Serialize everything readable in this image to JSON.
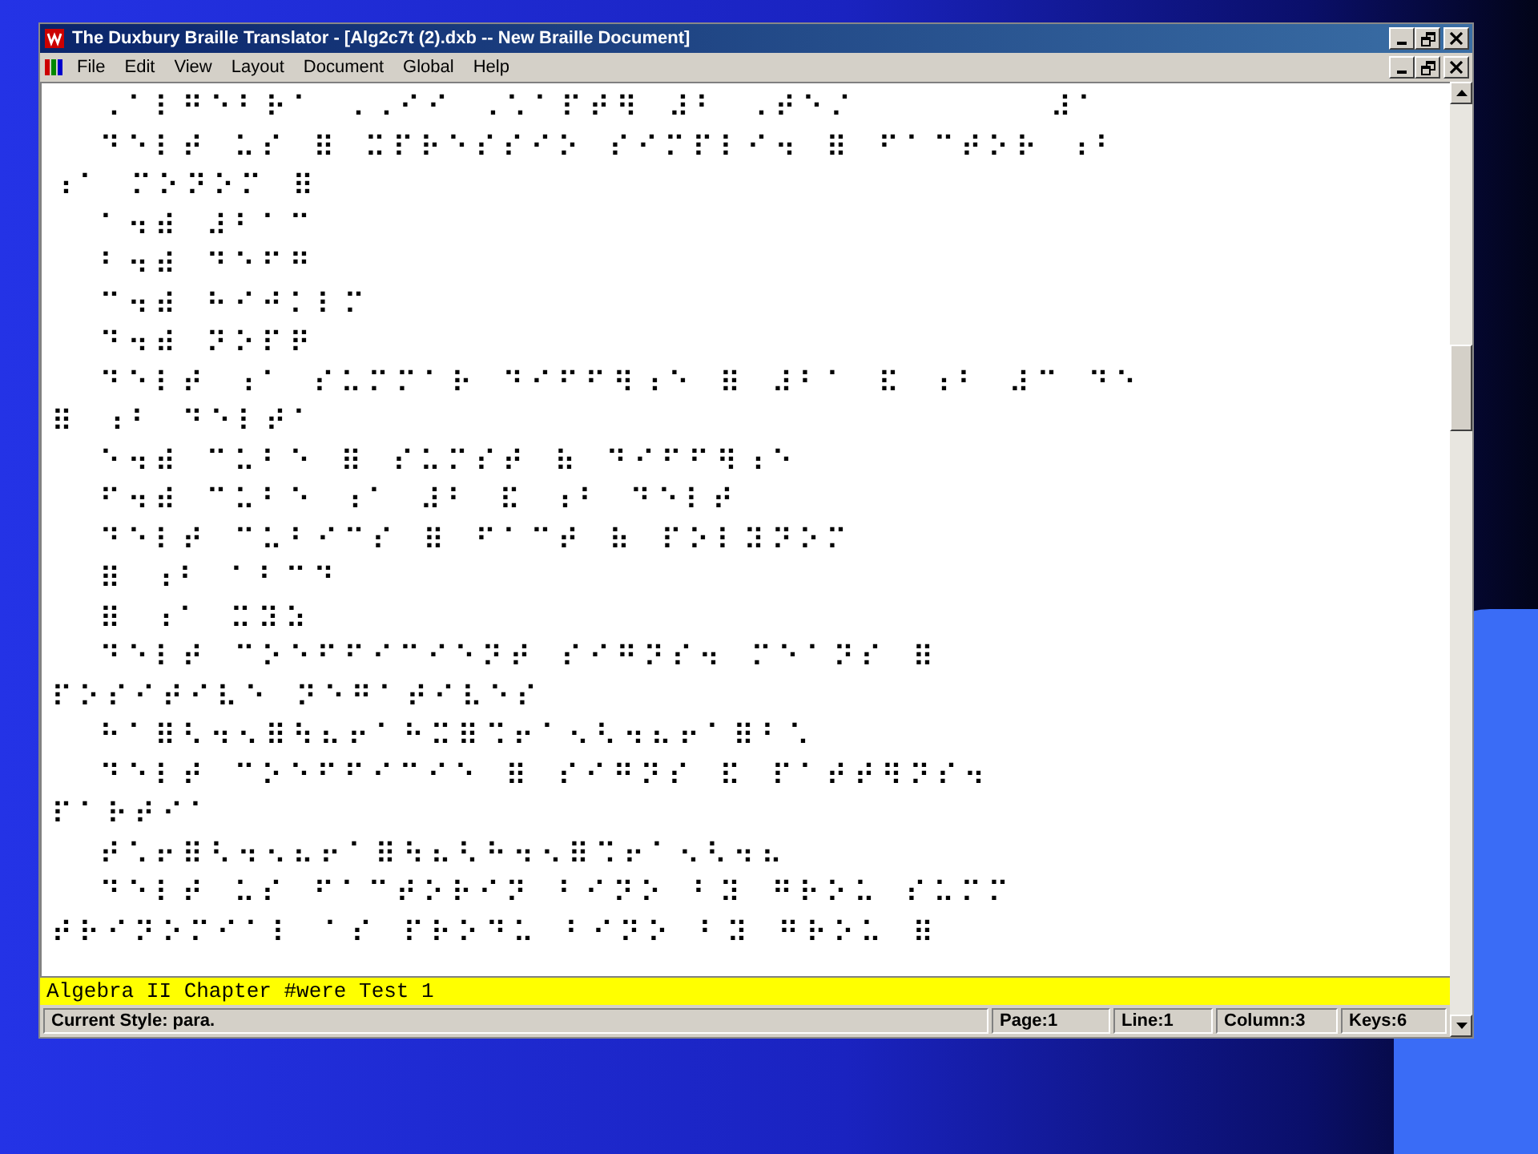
{
  "window": {
    "title": "The Duxbury Braille Translator - [Alg2c7t (2).dxb -- New Braille Document]"
  },
  "menu": [
    "File",
    "Edit",
    "View",
    "Layout",
    "Document",
    "Global",
    "Help"
  ],
  "document": {
    "lines": [
      "  ⠠⠁⠇⠛⠑⠃⠗⠁ ⠠⠠⠊⠊ ⠠⠡⠁⠏⠞⠻ ⠼⠃ ⠠⠞⠑⠌        ⠼⠁",
      "  ⠙⠑⠇⠞ ⠥⠎ ⠿ ⠭⠏⠗⠑⠎⠎⠊⠕ ⠎⠊⠍⠏⠇⠊⠲ ⠿ ⠋⠁⠉⠞⠕⠗ ⠰⠃",
      "⠰⠁ ⠍⠕⠝⠕⠍ ⠿",
      "  ⠁⠲⠾ ⠼⠃⠁⠉",
      "  ⠃⠲⠾ ⠙⠑⠋⠛",
      "  ⠉⠲⠾ ⠓⠊⠚⠅⠇⠍",
      "  ⠙⠲⠾ ⠝⠕⠏⠟",
      "  ⠙⠑⠇⠞ ⠰⠁ ⠎⠥⠍⠍⠁⠗ ⠙⠊⠋⠋⠻⠰⠑ ⠿ ⠼⠃⠁ ⠯ ⠰⠃ ⠼⠉ ⠙⠑",
      "⠿ ⠰⠃ ⠙⠑⠇⠞⠁",
      "  ⠑⠲⠾ ⠉⠥⠃⠑ ⠿ ⠎⠥⠍⠎⠞ ⠷ ⠙⠊⠋⠋⠻⠰⠑",
      "  ⠋⠲⠾ ⠉⠥⠃⠑ ⠰⠁ ⠼⠃ ⠯ ⠰⠃ ⠙⠑⠇⠞",
      "  ⠙⠑⠇⠞ ⠉⠥⠃⠊⠉⠎ ⠿ ⠋⠁⠉⠞ ⠷ ⠏⠕⠇⠽⠝⠕⠍",
      "  ⠿ ⠰⠃ ⠁⠃⠉⠙",
      "  ⠿ ⠰⠁ ⠭⠽⠵",
      "  ⠙⠑⠇⠞ ⠉⠕⠑⠋⠋⠊⠉⠊⠑⠝⠞ ⠎⠊⠛⠝⠎⠲ ⠍⠑⠁⠝⠎ ⠿",
      "⠏⠕⠎⠊⠞⠊⠧⠑ ⠝⠑⠛⠁⠞⠊⠧⠑⠎",
      "  ⠓⠁⠿⠣⠲⠢⠿⠳⠦⠖⠁⠓⠭⠿⠩⠖⠁⠢⠣⠲⠦⠖⠁⠿⠃⠡",
      "  ⠙⠑⠇⠞ ⠉⠕⠑⠋⠋⠊⠉⠊⠑ ⠿ ⠎⠊⠛⠝⠎ ⠯ ⠏⠁⠞⠞⠻⠝⠎⠲",
      "⠏⠁⠗⠞⠊⠁",
      "  ⠞⠡⠖⠿⠣⠲⠢⠦⠖⠁⠿⠳⠦⠣⠓⠲⠢⠿⠩⠖⠁⠢⠣⠲⠦",
      "  ⠙⠑⠇⠞ ⠥⠎ ⠋⠁⠉⠞⠕⠗⠊⠝ ⠃⠊⠝⠕ ⠃⠽ ⠛⠗⠕⠥ ⠎⠥⠍⠍",
      "⠞⠗⠊⠝⠕⠍⠊⠁⠇ ⠁⠎ ⠏⠗⠕⠙⠥ ⠃⠊⠝⠕ ⠃⠽ ⠛⠗⠕⠥ ⠿"
    ]
  },
  "print_line": "Algebra II Chapter #were Test 1",
  "status_bar": [
    "Current Style: para.",
    "Page:1",
    "Line:1",
    "Column:3",
    "Keys:6"
  ]
}
